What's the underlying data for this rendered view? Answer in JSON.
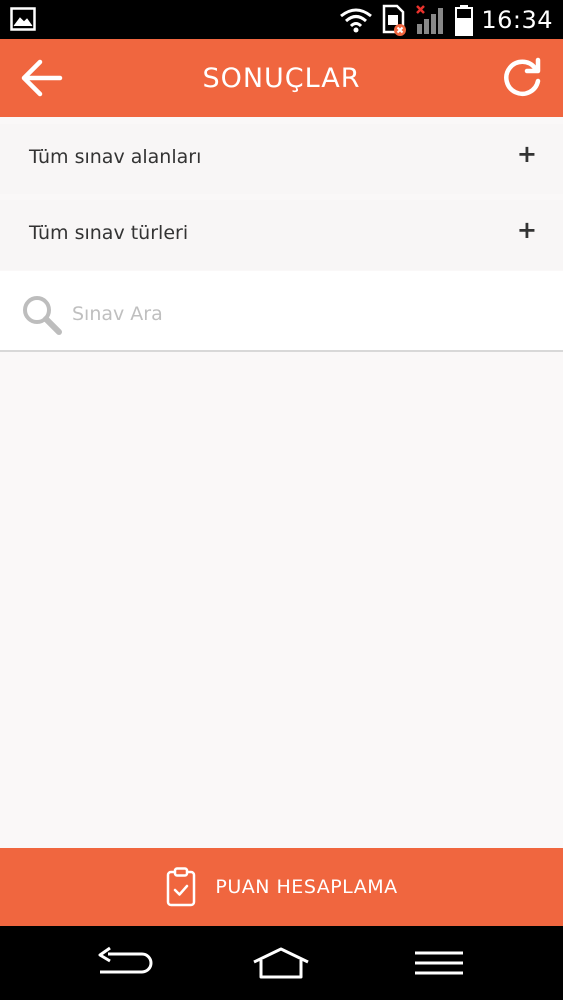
{
  "status_bar": {
    "time": "16:34",
    "icons": [
      "image-icon",
      "wifi-icon",
      "sim-card-error-icon",
      "signal-off-icon",
      "battery-icon"
    ]
  },
  "app_bar": {
    "title": "SONUÇLAR",
    "back_icon": "arrow-left-icon",
    "refresh_icon": "refresh-icon"
  },
  "filters": [
    {
      "label": "Tüm sınav alanları",
      "action_icon": "+"
    },
    {
      "label": "Tüm sınav türleri",
      "action_icon": "+"
    }
  ],
  "search": {
    "placeholder": "Sınav Ara",
    "value": ""
  },
  "bottom_button": {
    "label": "PUAN HESAPLAMA",
    "icon": "clipboard-check-icon"
  },
  "nav_bar": {
    "icons": [
      "back-nav-icon",
      "home-nav-icon",
      "menu-nav-icon"
    ]
  },
  "colors": {
    "accent": "#f0663f",
    "background": "#faf8f8",
    "row_background": "#f8f6f6",
    "text": "#333333",
    "placeholder": "#bfbfbf"
  }
}
